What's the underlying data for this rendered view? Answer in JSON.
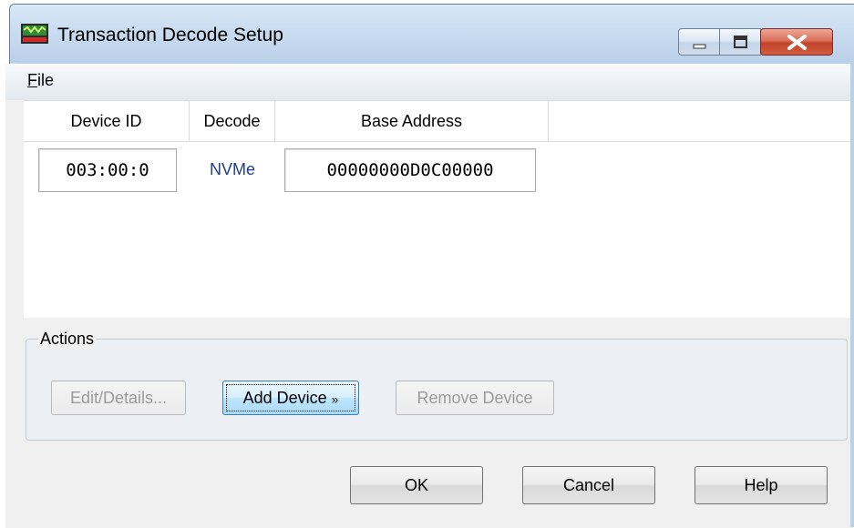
{
  "window": {
    "title": "Transaction Decode Setup",
    "icon": "decode-app-icon",
    "controls": [
      "minimize-icon",
      "maximize-icon",
      "close-icon"
    ]
  },
  "menu": {
    "file": {
      "accel": "F",
      "rest": "ile"
    }
  },
  "table": {
    "columns": [
      "Device ID",
      "Decode",
      "Base Address"
    ],
    "rows": [
      {
        "device_id": "003:00:0",
        "decode": "NVMe",
        "base_address": "00000000D0C00000"
      }
    ]
  },
  "actions": {
    "label": "Actions",
    "edit": "Edit/Details...",
    "add": "Add Device",
    "add_icon": "double-chevron-down-icon",
    "remove": "Remove Device"
  },
  "dialog_buttons": {
    "ok": "OK",
    "cancel": "Cancel",
    "help": "Help"
  },
  "colors": {
    "titlebar": "#c9dcf0",
    "close_button": "#c3432a",
    "decode_text": "#1f3d8a",
    "focus_button": "#bee6fd"
  }
}
